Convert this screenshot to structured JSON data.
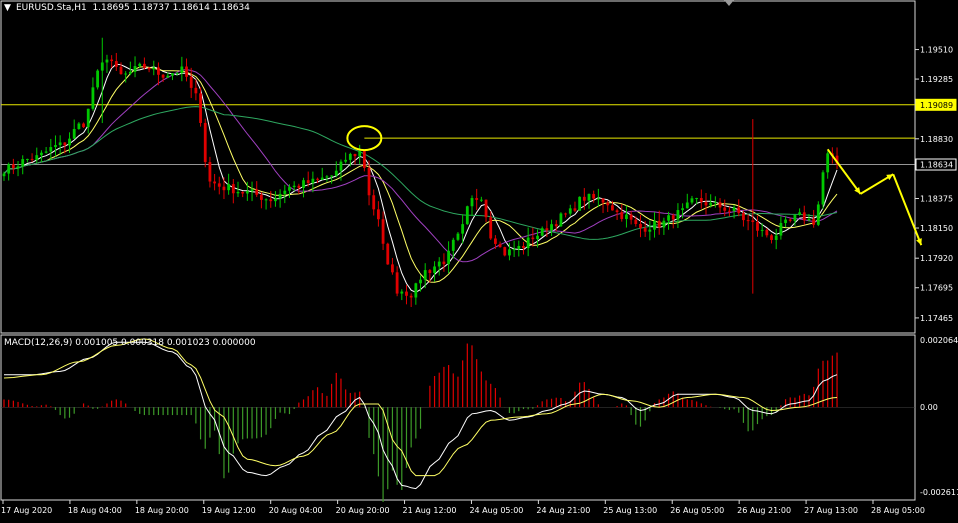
{
  "header": {
    "symbol_info": "EURUSD.Sta,H1  1.18695 1.18737 1.18614 1.18634",
    "macd_info": "MACD(12,26,9) 0.001005 0.000318 0.001023 0.000000"
  },
  "colors": {
    "background": "#000000",
    "frame": "#d8d8d8",
    "bull": "#00c800",
    "bear": "#e00000",
    "ma_fast": "#ffffff",
    "ma_med": "#ffff66",
    "ma_slow": "#a040c0",
    "ma_long": "#2ea860",
    "level_line": "#e8e800",
    "price_tag_bg": "#ffff00",
    "annotation": "#ffff00",
    "macd_signal": "#ffff66"
  },
  "chart_data": [
    {
      "type": "candlestick",
      "title": "EURUSD.Sta,H1",
      "ylim": [
        1.1735,
        1.1988
      ],
      "y_ticks": [
        "1.19510",
        "1.19285",
        "1.18830",
        "1.18375",
        "1.18150",
        "1.17920",
        "1.17695",
        "1.17465"
      ],
      "y_tick_values": [
        1.1951,
        1.19285,
        1.1883,
        1.18375,
        1.1815,
        1.1792,
        1.17695,
        1.17465
      ],
      "x_ticks": [
        "17 Aug 2020",
        "18 Aug 04:00",
        "18 Aug 20:00",
        "19 Aug 12:00",
        "20 Aug 04:00",
        "20 Aug 20:00",
        "21 Aug 12:00",
        "24 Aug 05:00",
        "24 Aug 21:00",
        "25 Aug 13:00",
        "26 Aug 05:00",
        "26 Aug 21:00",
        "27 Aug 13:00",
        "28 Aug 05:00"
      ],
      "price_tags": [
        {
          "label": "1.19089",
          "value": 1.19089,
          "style": "yellow"
        },
        {
          "label": "1.18634",
          "value": 1.18634,
          "style": "black"
        }
      ],
      "horizontal_levels": [
        1.19089,
        1.18835
      ],
      "current_price_line": 1.18634,
      "anchors": [
        [
          0,
          1.186
        ],
        [
          6,
          1.1868
        ],
        [
          12,
          1.1878
        ],
        [
          17,
          1.1895
        ],
        [
          20,
          1.1932
        ],
        [
          22,
          1.1946
        ],
        [
          25,
          1.1931
        ],
        [
          30,
          1.1938
        ],
        [
          34,
          1.1932
        ],
        [
          38,
          1.1935
        ],
        [
          41,
          1.1915
        ],
        [
          44,
          1.185
        ],
        [
          47,
          1.1846
        ],
        [
          52,
          1.1842
        ],
        [
          57,
          1.1837
        ],
        [
          61,
          1.1846
        ],
        [
          66,
          1.185
        ],
        [
          70,
          1.1855
        ],
        [
          74,
          1.187
        ],
        [
          76,
          1.1873
        ],
        [
          79,
          1.183
        ],
        [
          82,
          1.179
        ],
        [
          84,
          1.1768
        ],
        [
          87,
          1.1765
        ],
        [
          90,
          1.1782
        ],
        [
          94,
          1.179
        ],
        [
          97,
          1.1808
        ],
        [
          100,
          1.1836
        ],
        [
          102,
          1.184
        ],
        [
          104,
          1.181
        ],
        [
          107,
          1.1796
        ],
        [
          110,
          1.18
        ],
        [
          114,
          1.181
        ],
        [
          117,
          1.1818
        ],
        [
          120,
          1.1825
        ],
        [
          124,
          1.1838
        ],
        [
          128,
          1.1836
        ],
        [
          132,
          1.1825
        ],
        [
          136,
          1.1815
        ],
        [
          140,
          1.1818
        ],
        [
          144,
          1.1826
        ],
        [
          148,
          1.1836
        ],
        [
          152,
          1.1832
        ],
        [
          156,
          1.1828
        ],
        [
          159,
          1.182
        ],
        [
          162,
          1.1812
        ],
        [
          164,
          1.1808
        ],
        [
          167,
          1.1818
        ],
        [
          170,
          1.1824
        ],
        [
          173,
          1.182
        ],
        [
          176,
          1.187
        ],
        [
          178,
          1.1864
        ]
      ],
      "spikes": [
        {
          "index": 160,
          "high": 1.1898,
          "low": 1.1765
        },
        {
          "index": 21,
          "high": 1.196,
          "low": 1.1895
        }
      ],
      "forecast_path": [
        [
          176,
          1.1875
        ],
        [
          183,
          1.1841
        ],
        [
          190,
          1.1856
        ],
        [
          196,
          1.1802
        ]
      ]
    },
    {
      "type": "macd",
      "title": "MACD(12,26,9)",
      "ylim": [
        -0.00285,
        0.00222
      ],
      "y_ticks": [
        "0.002064",
        "0.00",
        "-0.002611"
      ],
      "y_tick_values": [
        0.002064,
        0.0,
        -0.002611
      ],
      "macd_anchors": [
        [
          0,
          0.001
        ],
        [
          6,
          0.001
        ],
        [
          12,
          0.0011
        ],
        [
          18,
          0.0015
        ],
        [
          24,
          0.002
        ],
        [
          30,
          0.002
        ],
        [
          36,
          0.0017
        ],
        [
          40,
          0.0012
        ],
        [
          44,
          -0.0002
        ],
        [
          48,
          -0.0014
        ],
        [
          52,
          -0.002
        ],
        [
          56,
          -0.0021
        ],
        [
          60,
          -0.0018
        ],
        [
          64,
          -0.0014
        ],
        [
          68,
          -0.0008
        ],
        [
          72,
          -0.0002
        ],
        [
          76,
          0.0003
        ],
        [
          79,
          -0.0005
        ],
        [
          82,
          -0.0016
        ],
        [
          85,
          -0.0024
        ],
        [
          88,
          -0.0025
        ],
        [
          92,
          -0.0017
        ],
        [
          96,
          -0.001
        ],
        [
          100,
          -0.0002
        ],
        [
          104,
          -0.0001
        ],
        [
          108,
          -0.0004
        ],
        [
          112,
          -0.0003
        ],
        [
          116,
          -0.0001
        ],
        [
          120,
          0.0001
        ],
        [
          124,
          0.0005
        ],
        [
          128,
          0.0004
        ],
        [
          132,
          0.0003
        ],
        [
          136,
          -0.0001
        ],
        [
          140,
          0.0001
        ],
        [
          144,
          0.0004
        ],
        [
          148,
          0.0004
        ],
        [
          152,
          0.0004
        ],
        [
          156,
          0.0003
        ],
        [
          160,
          -0.0001
        ],
        [
          164,
          -0.0002
        ],
        [
          168,
          0.0001
        ],
        [
          172,
          0.0002
        ],
        [
          175,
          0.0008
        ],
        [
          178,
          0.001
        ]
      ],
      "signal_anchors": [
        [
          0,
          0.0009
        ],
        [
          8,
          0.001
        ],
        [
          16,
          0.0014
        ],
        [
          24,
          0.0019
        ],
        [
          30,
          0.0021
        ],
        [
          36,
          0.0018
        ],
        [
          40,
          0.0013
        ],
        [
          46,
          -0.0002
        ],
        [
          52,
          -0.0016
        ],
        [
          58,
          -0.0018
        ],
        [
          64,
          -0.0015
        ],
        [
          70,
          -0.0008
        ],
        [
          76,
          0.0001
        ],
        [
          80,
          0.0001
        ],
        [
          84,
          -0.0012
        ],
        [
          88,
          -0.0021
        ],
        [
          92,
          -0.0021
        ],
        [
          98,
          -0.0012
        ],
        [
          104,
          -0.0004
        ],
        [
          110,
          -0.0003
        ],
        [
          116,
          -0.0002
        ],
        [
          122,
          0.0001
        ],
        [
          128,
          0.0004
        ],
        [
          134,
          0.0002
        ],
        [
          140,
          0.0
        ],
        [
          146,
          0.0003
        ],
        [
          152,
          0.0004
        ],
        [
          158,
          0.0003
        ],
        [
          164,
          -0.0001
        ],
        [
          170,
          0.0
        ],
        [
          178,
          0.0003
        ]
      ]
    }
  ]
}
